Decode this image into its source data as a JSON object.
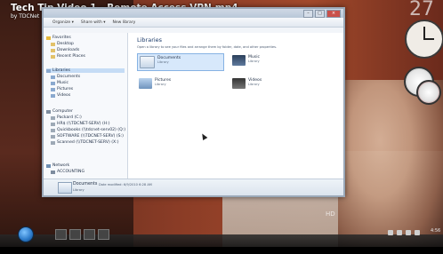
{
  "video": {
    "title": "Tech Tip Video 1 - Remote Access VPN.mp4",
    "author": "by TDCNet"
  },
  "window": {
    "toolbar": [
      "Organize ▾",
      "Share with ▾",
      "New library"
    ],
    "nav": {
      "favorites_header": "Favorites",
      "favorites": [
        "Desktop",
        "Downloads",
        "Recent Places"
      ],
      "libraries_header": "Libraries",
      "libraries": [
        "Documents",
        "Music",
        "Pictures",
        "Videos"
      ],
      "computer_header": "Computer",
      "drives": [
        "Packard (C:)",
        "HR$ (\\\\TDCNET-SERV) (H:)",
        "Quickbooks (\\\\tdcnet-serv02) (Q:)",
        "SOFTWARE (\\\\TDCNET-SERV) (S:)",
        "Scanned (\\\\TDCNET-SERV) (X:)"
      ],
      "network_header": "Network",
      "network": [
        "ACCOUNTING"
      ]
    },
    "content": {
      "title": "Libraries",
      "description": "Open a library to see your files and arrange them by folder, date, and other properties.",
      "items": [
        {
          "name": "Documents",
          "type": "Library"
        },
        {
          "name": "Music",
          "type": "Library"
        },
        {
          "name": "Pictures",
          "type": "Library"
        },
        {
          "name": "Videos",
          "type": "Library"
        }
      ]
    },
    "details": {
      "name": "Documents",
      "meta": "Date modified: 6/9/2010 6:28 AM",
      "type": "Library"
    }
  },
  "overlay": {
    "calendar_day": "27",
    "hd": "HD"
  },
  "taskbar": {
    "time": "4:56"
  }
}
